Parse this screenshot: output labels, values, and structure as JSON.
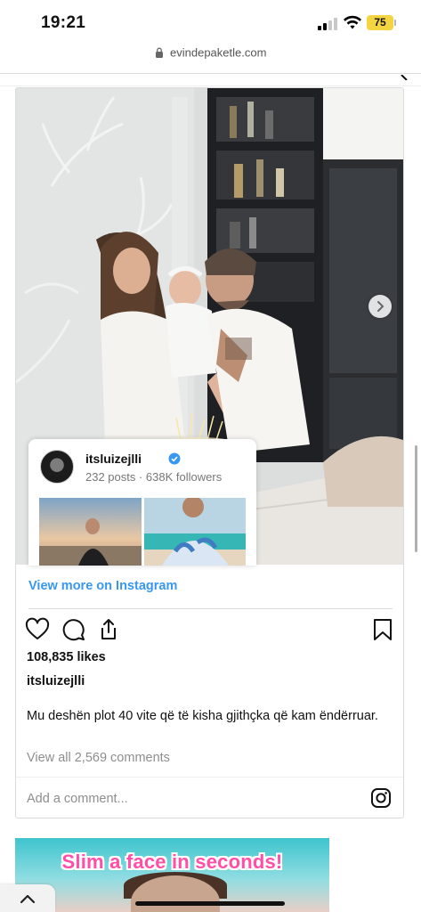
{
  "status_bar": {
    "time": "19:21",
    "battery": "75",
    "battery_color": "#f5d442"
  },
  "browser": {
    "url": "evindepaketle.com",
    "lock_icon": "lock-icon"
  },
  "embed": {
    "profile_card": {
      "username": "itsluizejlli",
      "verified": true,
      "meta": "232 posts · 638K followers"
    },
    "view_more": "View more on Instagram",
    "icons": [
      "heart-icon",
      "comment-icon",
      "share-icon",
      "bookmark-icon"
    ],
    "likes": "108,835 likes",
    "caption_user": "itsluizejlli",
    "caption": "Mu deshën plot 40 vite që të kisha gjithçka që kam ëndërruar.",
    "view_all_comments": "View all 2,569 comments",
    "add_comment_placeholder": "Add a comment...",
    "accent_color": "#3897f0"
  },
  "ad": {
    "headline": "Slim a face in seconds!",
    "headline_color": "#ff4fa6"
  }
}
